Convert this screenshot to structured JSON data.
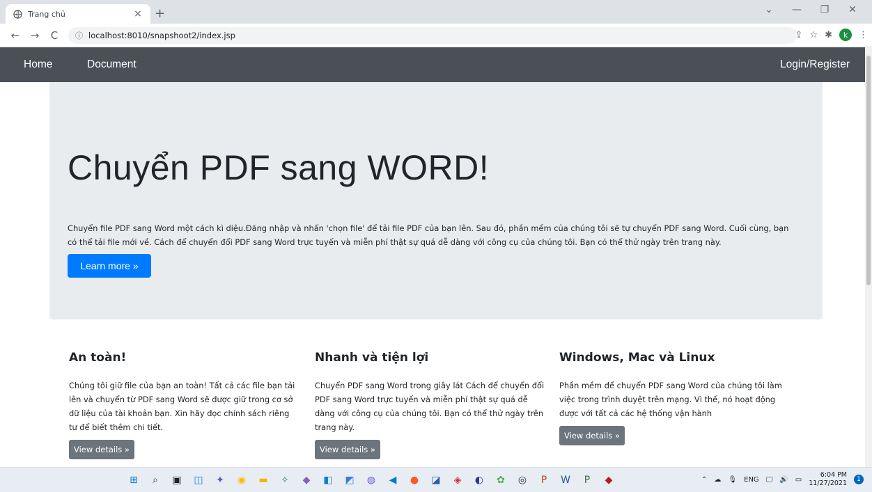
{
  "browser": {
    "tab_title": "Trang chủ",
    "tab_close": "×",
    "new_tab": "+",
    "url": "localhost:8010/snapshoot2/index.jsp",
    "window_controls": [
      "⌄",
      "—",
      "❐",
      "✕"
    ],
    "back": "←",
    "forward": "→",
    "reload": "C",
    "profile_initial": "k"
  },
  "navbar": {
    "home": "Home",
    "document": "Document",
    "login": "Login/Register"
  },
  "jumbotron": {
    "heading": "Chuyển PDF sang WORD!",
    "text": "Chuyển file PDF sang Word một cách kì diệu.Đăng nhập và nhấn 'chọn file' để tải file PDF của bạn lên. Sau đó, phần mềm của chúng tôi sẽ tự chuyển PDF sang Word. Cuối cùng, bạn có thể tải file mới về. Cách để chuyển đổi PDF sang Word trực tuyến và miễn phí thật sự quá dễ dàng với công cụ của chúng tôi. Bạn có thể thử ngày trên trang này.",
    "button": "Learn more »"
  },
  "features": [
    {
      "heading": "An toàn!",
      "text": "Chúng tôi giữ file của bạn an toàn! Tất cả các file bạn tải lên và chuyển từ PDF sang Word sẽ được giữ trong cơ sở dữ liệu của tài khoản bạn. Xin hãy đọc chính sách riêng tư để biết thêm chi tiết.",
      "button": "View details »"
    },
    {
      "heading": "Nhanh và tiện lợi",
      "text": "Chuyển PDF sang Word trong giây lát Cách để chuyển đổi PDF sang Word trực tuyến và miễn phí thật sự quá dễ dàng với công cụ của chúng tôi. Bạn có thể thử ngày trên trang này.",
      "button": "View details »"
    },
    {
      "heading": "Windows, Mac và Linux",
      "text": "Phần mềm để chuyển PDF sang Word của chúng tôi làm việc trong trình duyệt trên mạng. Vì thế, nó hoạt động được với tất cả các hệ thống vận hành",
      "button": "View details »"
    }
  ],
  "taskbar": {
    "language": "ENG",
    "time": "6:04 PM",
    "date": "11/27/2021",
    "notification_count": "1",
    "icons": [
      "windows-start-icon",
      "search-icon",
      "task-view-icon",
      "widgets-icon",
      "teams-icon",
      "chrome-icon",
      "file-explorer-icon",
      "app-icon",
      "visual-studio-icon",
      "app-icon",
      "app-icon",
      "app-icon",
      "vscode-icon",
      "app-icon",
      "app-icon",
      "app-icon",
      "app-icon",
      "app-icon",
      "steam-icon",
      "powerpoint-icon",
      "word-icon",
      "project-icon",
      "app-icon"
    ]
  },
  "colors": {
    "navbar": "#4a5056",
    "jumbotron": "#e9ecef",
    "primary": "#007bff",
    "secondary": "#6c757d"
  }
}
